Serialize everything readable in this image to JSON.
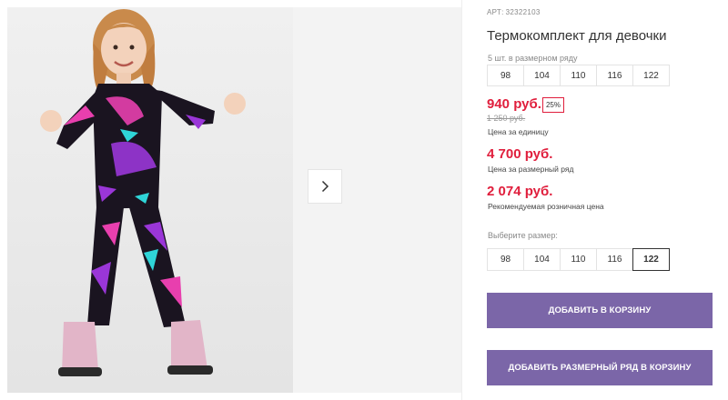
{
  "product": {
    "sku_label": "АРТ:",
    "sku": "32322103",
    "title": "Термокомплект для девочки"
  },
  "size_run": {
    "label": "5 шт. в размерном ряду",
    "sizes": [
      "98",
      "104",
      "110",
      "116",
      "122"
    ]
  },
  "pricing": {
    "unit_price": "940 руб.",
    "discount": "25%",
    "old_price": "1 250 руб.",
    "unit_caption": "Цена за единицу",
    "run_price": "4 700 руб.",
    "run_caption": "Цена за размерный ряд",
    "rrp": "2 074 руб.",
    "rrp_caption": "Рекомендуемая розничная цена"
  },
  "size_select": {
    "label": "Выберите размер:",
    "sizes": [
      "98",
      "104",
      "110",
      "116",
      "122"
    ],
    "selected": "122"
  },
  "actions": {
    "add_to_cart": "ДОБАВИТЬ В КОРЗИНУ",
    "add_run_to_cart": "ДОБАВИТЬ РАЗМЕРНЫЙ РЯД В КОРЗИНУ"
  },
  "colors": {
    "accent": "#7b66a8",
    "price": "#e01e3c",
    "outfit_base": "#1a1420",
    "outfit_purple": "#9a36d8",
    "outfit_pink": "#e83fae",
    "outfit_cyan": "#2fd5d8"
  },
  "icons": {
    "next": "chevron-right-icon"
  }
}
